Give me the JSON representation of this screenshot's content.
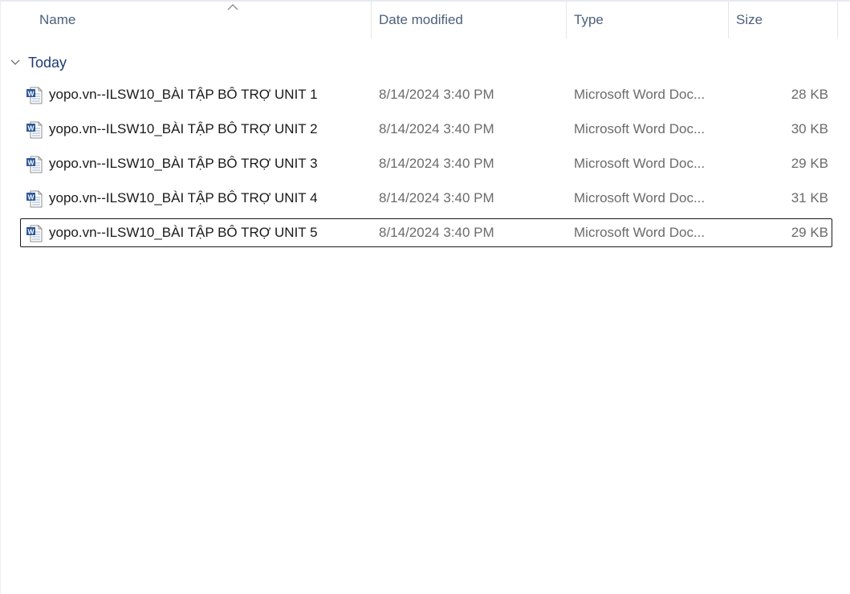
{
  "columns": {
    "name": "Name",
    "date_modified": "Date modified",
    "type": "Type",
    "size": "Size"
  },
  "sort": {
    "column": "name",
    "icon": "sort-ascending-caret-icon"
  },
  "group": {
    "label": "Today",
    "expanded": true,
    "icon": "chevron-down-icon"
  },
  "files": [
    {
      "name": "yopo.vn--ILSW10_BÀI TẬP BÔ TRỢ UNIT 1",
      "date": "8/14/2024 3:40 PM",
      "type": "Microsoft Word Doc...",
      "size": "28 KB",
      "icon": "word-document-icon"
    },
    {
      "name": "yopo.vn--ILSW10_BÀI TẬP BÔ TRỢ UNIT 2",
      "date": "8/14/2024 3:40 PM",
      "type": "Microsoft Word Doc...",
      "size": "30 KB",
      "icon": "word-document-icon"
    },
    {
      "name": "yopo.vn--ILSW10_BÀI TẬP BÔ TRỢ UNIT 3",
      "date": "8/14/2024 3:40 PM",
      "type": "Microsoft Word Doc...",
      "size": "29 KB",
      "icon": "word-document-icon"
    },
    {
      "name": "yopo.vn--ILSW10_BÀI TẬP BÔ TRỢ UNIT 4",
      "date": "8/14/2024 3:40 PM",
      "type": "Microsoft Word Doc...",
      "size": "31 KB",
      "icon": "word-document-icon"
    },
    {
      "name": "yopo.vn--ILSW10_BÀI TẬP BÔ TRỢ UNIT 5",
      "date": "8/14/2024 3:40 PM",
      "type": "Microsoft Word Doc...",
      "size": "29 KB",
      "icon": "word-document-icon",
      "focused": true
    }
  ],
  "colors": {
    "header_text": "#4c607a",
    "group_text": "#1e3a78",
    "word_icon_blue": "#2b579a"
  }
}
